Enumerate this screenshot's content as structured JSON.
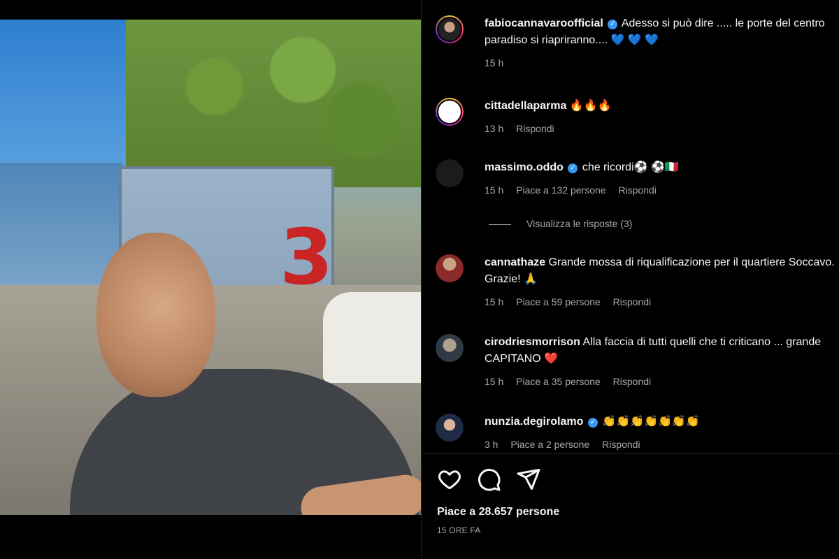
{
  "post": {
    "author": "fabiocannavaroofficial",
    "caption": "Adesso si può dire ..... le porte del centro paradiso si riapriranno....",
    "caption_emoji": "💙 💙 💙",
    "caption_time": "15 h",
    "likes_text": "Piace a 28.657 persone",
    "posted_ago": "15 ORE FA"
  },
  "photo": {
    "number": "3"
  },
  "comments": [
    {
      "user": "cittadellaparma",
      "verified": false,
      "text": "🔥🔥🔥",
      "time": "13 h",
      "likes": "",
      "reply": "Rispondi"
    },
    {
      "user": "massimo.oddo",
      "verified": true,
      "text": "che ricordi⚽ ⚽🇮🇹",
      "time": "15 h",
      "likes": "Piace a 132 persone",
      "reply": "Rispondi"
    },
    {
      "user": "cannathaze",
      "verified": false,
      "text": "Grande mossa di riqualificazione per il quartiere Soccavo. Grazie! 🙏",
      "time": "15 h",
      "likes": "Piace a 59 persone",
      "reply": "Rispondi"
    },
    {
      "user": "cirodriesmorrison",
      "verified": false,
      "text": "Alla faccia di tutti quelli che ti criticano ... grande CAPITANO ❤️",
      "time": "15 h",
      "likes": "Piace a 35 persone",
      "reply": "Rispondi"
    },
    {
      "user": "nunzia.degirolamo",
      "verified": true,
      "text": "👏👏👏👏👏👏👏",
      "time": "3 h",
      "likes": "Piace a 2 persone",
      "reply": "Rispondi"
    }
  ],
  "view_replies": "Visualizza le risposte (3)",
  "icons": {
    "like": "heart-icon",
    "comment": "comment-icon",
    "share": "share-icon",
    "verified": "verified-badge-icon"
  },
  "colors": {
    "background": "#000000",
    "text": "#f5f5f5",
    "muted": "#a8a8a8",
    "verified": "#3897f0"
  }
}
